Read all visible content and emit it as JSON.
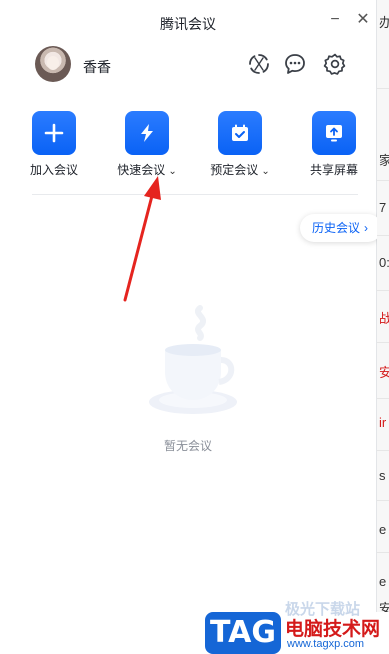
{
  "window": {
    "title": "腾讯会议",
    "minimize": "−",
    "close": "✕"
  },
  "user": {
    "name": "香香"
  },
  "top_icons": [
    "sync-icon",
    "chat-icon",
    "settings-icon"
  ],
  "actions": [
    {
      "label": "加入会议",
      "icon": "plus-icon",
      "has_caret": false
    },
    {
      "label": "快速会议",
      "icon": "lightning-icon",
      "has_caret": true
    },
    {
      "label": "预定会议",
      "icon": "calendar-check-icon",
      "has_caret": true
    },
    {
      "label": "共享屏幕",
      "icon": "share-screen-icon",
      "has_caret": false
    }
  ],
  "caret": "⌄",
  "history": {
    "label": "历史会议",
    "chevron": "›"
  },
  "empty_state": {
    "text": "暂无会议"
  },
  "background_fragments": [
    "办",
    "家",
    "7",
    "0:",
    "战",
    "安",
    "ir",
    "s",
    "e",
    "e",
    "安"
  ],
  "watermark": {
    "tag": "TAG",
    "title": "电脑技术网",
    "url": "www.tagxp.com",
    "faded": "极光下载站"
  },
  "colors": {
    "accent": "#0a62f5",
    "arrow": "#e5241f",
    "watermark_red": "#d41a1a"
  }
}
